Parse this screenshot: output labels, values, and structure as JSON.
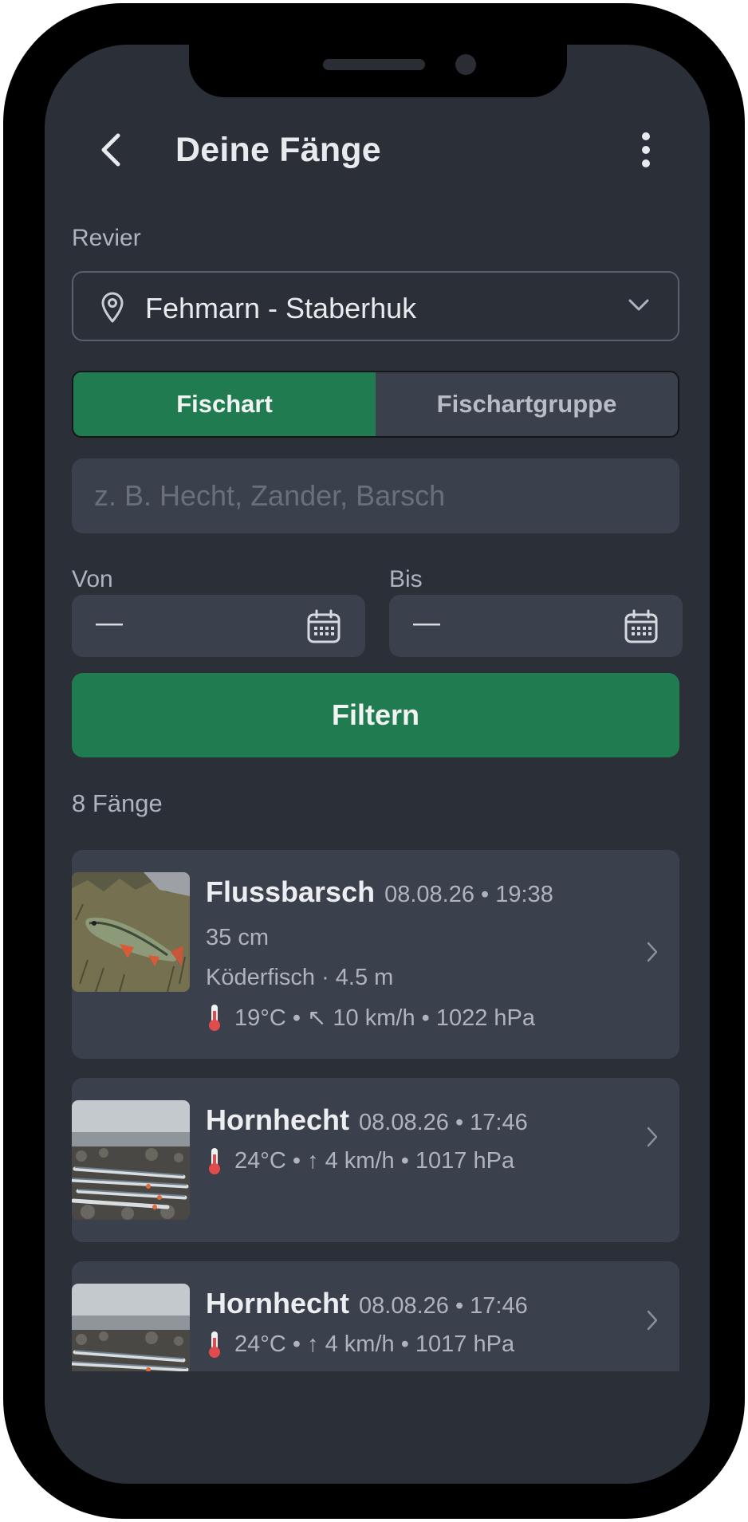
{
  "header": {
    "title": "Deine Fänge"
  },
  "revier": {
    "label": "Revier",
    "value": "Fehmarn - Staberhuk"
  },
  "segment": {
    "option_1": "Fischart",
    "option_2": "Fischartgruppe"
  },
  "search": {
    "placeholder": "z. B. Hecht, Zander, Barsch"
  },
  "dates": {
    "from_label": "Von",
    "from_value": "—",
    "to_label": "Bis",
    "to_value": "—"
  },
  "filter_button": "Filtern",
  "catch_count": "8 Fänge",
  "catches": [
    {
      "species": "Flussbarsch",
      "datetime": "08.08.26 • 19:38",
      "length": "35 cm",
      "bait": "Köderfisch · 4.5 m",
      "weather": "19°C • ↖ 10 km/h • 1022 hPa"
    },
    {
      "species": "Hornhecht",
      "datetime": "08.08.26 • 17:46",
      "weather": "24°C • ↑ 4 km/h • 1017 hPa"
    },
    {
      "species": "Hornhecht",
      "datetime": "08.08.26 • 17:46",
      "weather": "24°C • ↑ 4 km/h • 1017 hPa"
    }
  ],
  "colors": {
    "background": "#2b2f38",
    "surface": "#3b414c",
    "accent": "#217b51",
    "text_primary": "#e8eaee",
    "text_secondary": "#aeb3bd",
    "thermometer": "#e24b4b"
  },
  "icons": {
    "back": "chevron-left-icon",
    "menu": "more-vertical-icon",
    "location": "map-pin-icon",
    "dropdown": "chevron-down-icon",
    "calendar": "calendar-icon",
    "temperature": "thermometer-icon",
    "row_arrow": "chevron-right-icon"
  }
}
